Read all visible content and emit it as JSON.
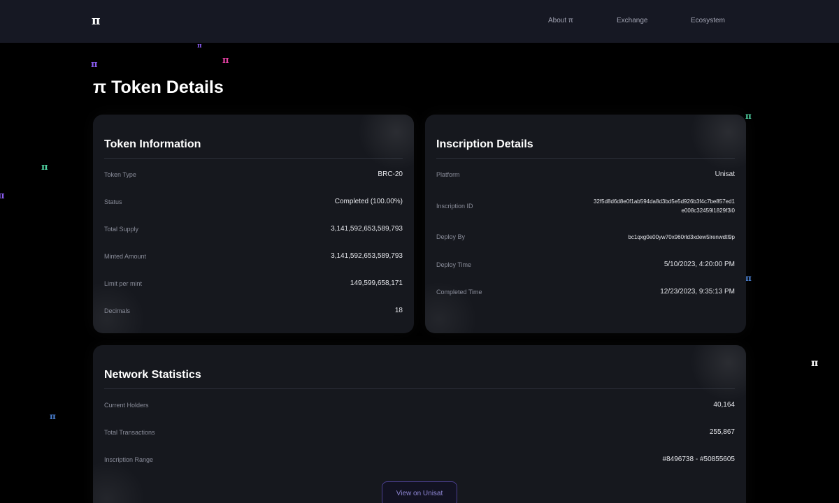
{
  "nav": {
    "logo": "π",
    "links": [
      "About π",
      "Exchange",
      "Ecosystem"
    ]
  },
  "page_title": "π Token Details",
  "token_info": {
    "title": "Token Information",
    "rows": [
      {
        "label": "Token Type",
        "value": "BRC-20"
      },
      {
        "label": "Status",
        "value": "Completed (100.00%)"
      },
      {
        "label": "Total Supply",
        "value": "3,141,592,653,589,793"
      },
      {
        "label": "Minted Amount",
        "value": "3,141,592,653,589,793"
      },
      {
        "label": "Limit per mint",
        "value": "149,599,658,171"
      },
      {
        "label": "Decimals",
        "value": "18"
      }
    ]
  },
  "inscription": {
    "title": "Inscription Details",
    "rows": [
      {
        "label": "Platform",
        "value": "Unisat"
      },
      {
        "label": "Inscription ID",
        "value": "32f5d8d6d8e0f1ab594da8d3bd5e5d926b3f4c7be857ed1e008c32459l1829f3i0"
      },
      {
        "label": "Deploy By",
        "value": "bc1qxg0e00yw70x960rld3xdew5lrenwdtl9p"
      },
      {
        "label": "Deploy Time",
        "value": "5/10/2023, 4:20:00 PM"
      },
      {
        "label": "Completed Time",
        "value": "12/23/2023, 9:35:13 PM"
      }
    ]
  },
  "network": {
    "title": "Network Statistics",
    "rows": [
      {
        "label": "Current Holders",
        "value": "40,164"
      },
      {
        "label": "Total Transactions",
        "value": "255,867"
      },
      {
        "label": "Inscription Range",
        "value": "#8496738 - #50855605"
      }
    ],
    "button": "View on Unisat"
  },
  "decor": {
    "glyph": "π",
    "colors": {
      "magenta": "#e040a0",
      "purple": "#8a5cf0",
      "green": "#4fd0a0",
      "blue": "#4a7fd0",
      "white": "#ffffff"
    }
  }
}
